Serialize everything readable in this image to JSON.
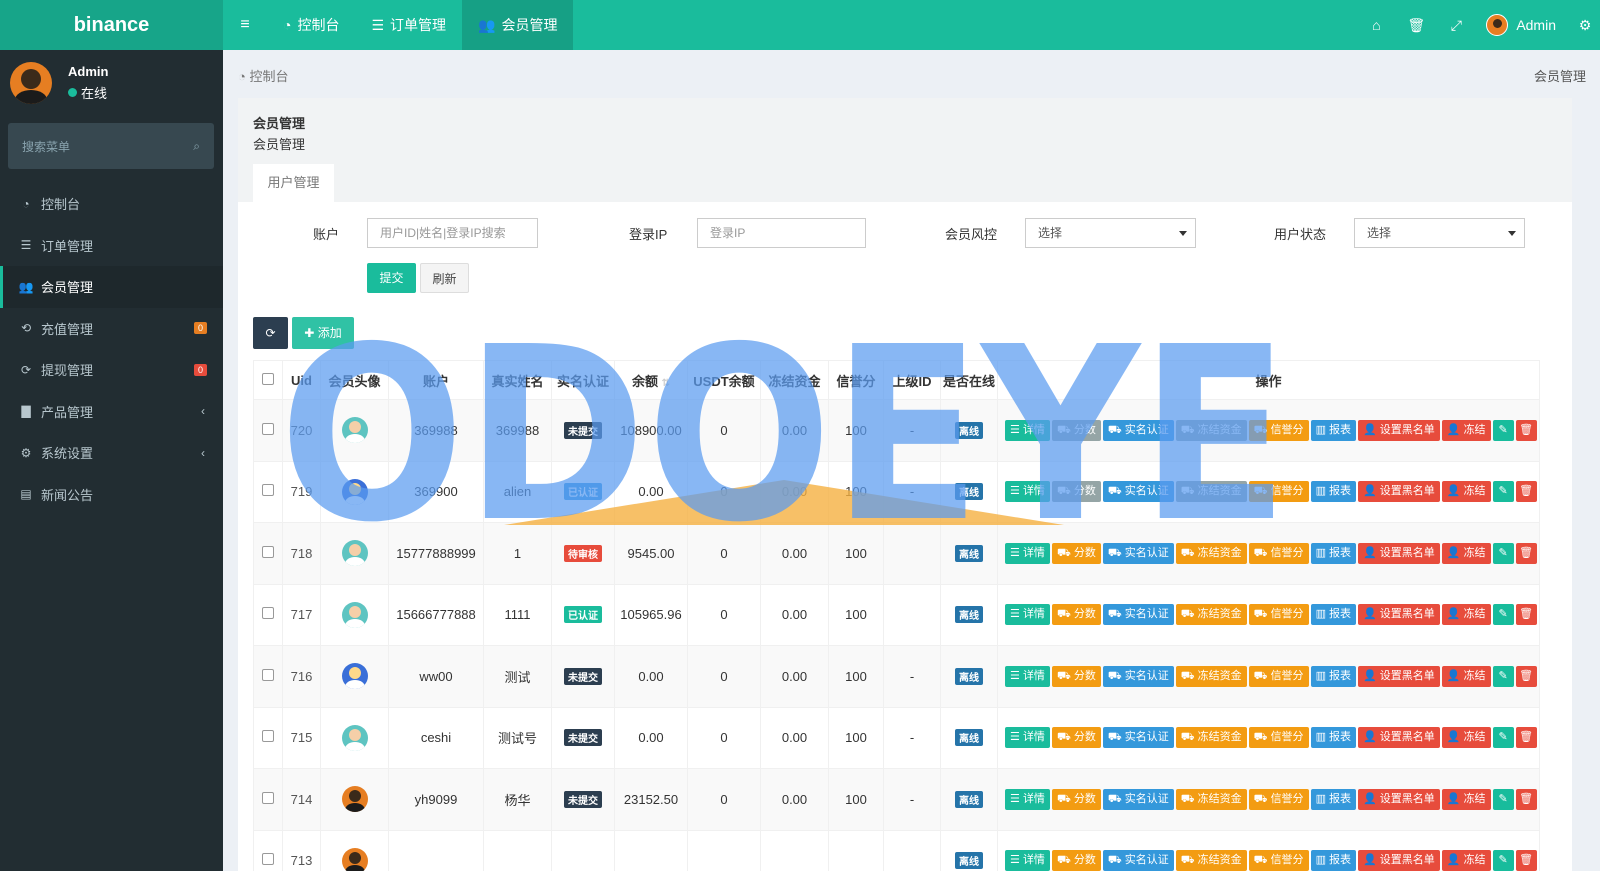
{
  "brand": "binance",
  "topbar": {
    "tabs": [
      {
        "label": "控制台",
        "icon": "dashboard-icon"
      },
      {
        "label": "订单管理",
        "icon": "list-icon"
      },
      {
        "label": "会员管理",
        "icon": "users-icon"
      }
    ],
    "user_name": "Admin"
  },
  "sidebar": {
    "user_name": "Admin",
    "status": "在线",
    "search_placeholder": "搜索菜单",
    "items": [
      {
        "label": "控制台",
        "icon": "dashboard-icon"
      },
      {
        "label": "订单管理",
        "icon": "list-icon"
      },
      {
        "label": "会员管理",
        "icon": "users-icon"
      },
      {
        "label": "充值管理",
        "icon": "recharge-icon",
        "badge": "0"
      },
      {
        "label": "提现管理",
        "icon": "withdraw-icon",
        "badge": "0"
      },
      {
        "label": "产品管理",
        "icon": "briefcase-icon"
      },
      {
        "label": "系统设置",
        "icon": "cogs-icon"
      },
      {
        "label": "新闻公告",
        "icon": "newspaper-icon"
      }
    ]
  },
  "breadcrumb": {
    "left": "控制台",
    "right": "会员管理"
  },
  "panel": {
    "title": "会员管理",
    "subtitle": "会员管理",
    "tab": "用户管理"
  },
  "filters": {
    "account_label": "账户",
    "account_placeholder": "用户ID|姓名|登录IP搜索",
    "ip_label": "登录IP",
    "ip_placeholder": "登录IP",
    "risk_label": "会员风控",
    "risk_value": "选择",
    "status_label": "用户状态",
    "status_value": "选择",
    "submit": "提交",
    "refresh": "刷新"
  },
  "toolbar": {
    "add": "添加"
  },
  "table": {
    "headers": [
      "Uid",
      "会员头像",
      "账户",
      "真实姓名",
      "实名认证",
      "余额",
      "USDT余额",
      "冻结资金",
      "信誉分",
      "上级ID",
      "是否在线",
      "操作"
    ],
    "actions": [
      "详情",
      "分数",
      "实名认证",
      "冻结资金",
      "信誉分",
      "报表",
      "设置黑名单",
      "冻结"
    ],
    "rows": [
      {
        "uid": "720",
        "avatar": "teal",
        "account": "369988",
        "name": "369988",
        "auth": "未提交",
        "auth_color": "dark",
        "balance": "108900.00",
        "usdt": "0",
        "frozen": "0.00",
        "credit": "100",
        "parent": "-",
        "online": "离线"
      },
      {
        "uid": "719",
        "avatar": "blue",
        "account": "369900",
        "name": "alien",
        "auth": "已认证",
        "auth_color": "blue",
        "balance": "0.00",
        "usdt": "0",
        "frozen": "0.00",
        "credit": "100",
        "parent": "-",
        "online": "离线"
      },
      {
        "uid": "718",
        "avatar": "teal",
        "account": "15777888999",
        "name": "1",
        "auth": "待审核",
        "auth_color": "red",
        "balance": "9545.00",
        "usdt": "0",
        "frozen": "0.00",
        "credit": "100",
        "parent": "",
        "online": "离线"
      },
      {
        "uid": "717",
        "avatar": "teal",
        "account": "15666777888",
        "name": "1111",
        "auth": "已认证",
        "auth_color": "green",
        "balance": "105965.96",
        "usdt": "0",
        "frozen": "0.00",
        "credit": "100",
        "parent": "",
        "online": "离线"
      },
      {
        "uid": "716",
        "avatar": "blue",
        "account": "ww00",
        "name": "测试",
        "auth": "未提交",
        "auth_color": "dark",
        "balance": "0.00",
        "usdt": "0",
        "frozen": "0.00",
        "credit": "100",
        "parent": "-",
        "online": "离线"
      },
      {
        "uid": "715",
        "avatar": "teal",
        "account": "ceshi",
        "name": "测试号",
        "auth": "未提交",
        "auth_color": "dark",
        "balance": "0.00",
        "usdt": "0",
        "frozen": "0.00",
        "credit": "100",
        "parent": "-",
        "online": "离线"
      },
      {
        "uid": "714",
        "avatar": "orange",
        "account": "yh9099",
        "name": "杨华",
        "auth": "未提交",
        "auth_color": "dark",
        "balance": "23152.50",
        "usdt": "0",
        "frozen": "0.00",
        "credit": "100",
        "parent": "-",
        "online": "离线"
      },
      {
        "uid": "713",
        "avatar": "orange",
        "account": "",
        "name": "",
        "auth": "",
        "auth_color": "blue",
        "balance": "",
        "usdt": "",
        "frozen": "",
        "credit": "",
        "parent": "",
        "online": "离线"
      }
    ]
  },
  "watermark": "ODOEYE",
  "colors": {
    "primary": "#1abc9c",
    "sidebar": "#222d32",
    "watermark": "#5b9cf0",
    "watermark_accent": "#f5b041"
  }
}
